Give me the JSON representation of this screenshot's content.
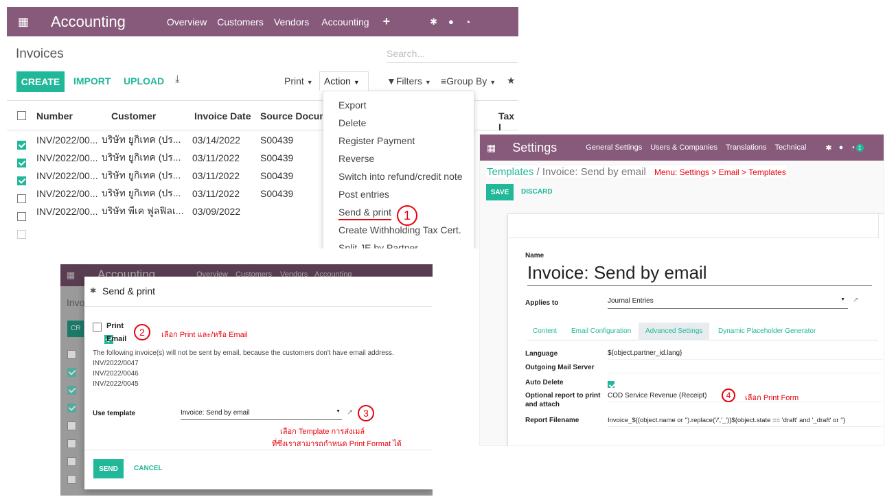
{
  "panel1": {
    "topbar": {
      "app": "Accounting",
      "menu": [
        "Overview",
        "Customers",
        "Vendors",
        "Accounting"
      ]
    },
    "breadcrumb": "Invoices",
    "search_placeholder": "Search...",
    "buttons": {
      "create": "CREATE",
      "import": "IMPORT",
      "upload": "UPLOAD"
    },
    "toolbar": {
      "print": "Print",
      "action": "Action",
      "filters": "Filters",
      "groupby": "Group By"
    },
    "columns": [
      "Number",
      "Customer",
      "Invoice Date",
      "Source Docum...",
      "Tax I"
    ],
    "rows": [
      {
        "checked": true,
        "number": "INV/2022/00...",
        "customer": "บริษัท ยูกิเทค (ปร...",
        "date": "03/14/2022",
        "source": "S00439"
      },
      {
        "checked": true,
        "number": "INV/2022/00...",
        "customer": "บริษัท ยูกิเทค (ปร...",
        "date": "03/11/2022",
        "source": "S00439"
      },
      {
        "checked": true,
        "number": "INV/2022/00...",
        "customer": "บริษัท ยูกิเทค (ปร...",
        "date": "03/11/2022",
        "source": "S00439"
      },
      {
        "checked": false,
        "number": "INV/2022/00...",
        "customer": "บริษัท ยูกิเทค (ปร...",
        "date": "03/11/2022",
        "source": "S00439"
      },
      {
        "checked": false,
        "number": "INV/2022/00...",
        "customer": "บริษัท พีเค ฟูลฟิลเ...",
        "date": "03/09/2022",
        "source": ""
      }
    ],
    "action_menu": [
      "Export",
      "Delete",
      "Register Payment",
      "Reverse",
      "Switch into refund/credit note",
      "Post entries",
      "Send & print",
      "Create Withholding Tax Cert.",
      "Split JE by Partner"
    ],
    "step_mark": "1"
  },
  "panel2": {
    "topbar": {
      "app": "Settings",
      "menu": [
        "General Settings",
        "Users & Companies",
        "Translations",
        "Technical"
      ],
      "badge": "1"
    },
    "breadcrumb_link": "Templates",
    "breadcrumb_rest": " / Invoice: Send by email",
    "menu_note": "Menu: Settings > Email > Templates",
    "buttons": {
      "save": "SAVE",
      "discard": "DISCARD"
    },
    "name_label": "Name",
    "name_value": "Invoice: Send by email",
    "applies_label": "Applies to",
    "applies_value": "Journal Entries",
    "tabs": [
      "Content",
      "Email Configuration",
      "Advanced Settings",
      "Dynamic Placeholder Generator"
    ],
    "fields": {
      "language_label": "Language",
      "language_value": "${object.partner_id.lang}",
      "server_label": "Outgoing Mail Server",
      "autodelete_label": "Auto Delete",
      "report_label": "Optional report to print and attach",
      "report_value": "COD Service Revenue (Receipt)",
      "filename_label": "Report Filename",
      "filename_value": "Invoice_${(object.name or '').replace('/','_')}${object.state == 'draft' and '_draft' or ''}"
    },
    "step_mark": "4",
    "step_note": "เลือก Print Form"
  },
  "panel3": {
    "title": "Send & print",
    "print_label": "Print",
    "email_label": "Email",
    "step2_mark": "2",
    "step2_note": "เลือก Print และ/หรือ Email",
    "warning": "The following invoice(s) will not be sent by email, because the customers don't have email address.",
    "invoices": [
      "INV/2022/0047",
      "INV/2022/0046",
      "INV/2022/0045"
    ],
    "template_label": "Use template",
    "template_value": "Invoice: Send by email",
    "step3_mark": "3",
    "step3_note1": "เลือก Template การส่งเมล์",
    "step3_note2": "ที่ซึ่งเราสามารถกำหนด Print Format ได้",
    "send": "SEND",
    "cancel": "CANCEL",
    "bg_app": "Accounting",
    "bg_menu": [
      "Overview",
      "Customers",
      "Vendors",
      "Accounting"
    ],
    "bg_breadcrumb": "Invo",
    "bg_button": "CR"
  },
  "colors": {
    "purple": "#875a7b",
    "teal": "#21b799",
    "red": "#e8000b"
  }
}
